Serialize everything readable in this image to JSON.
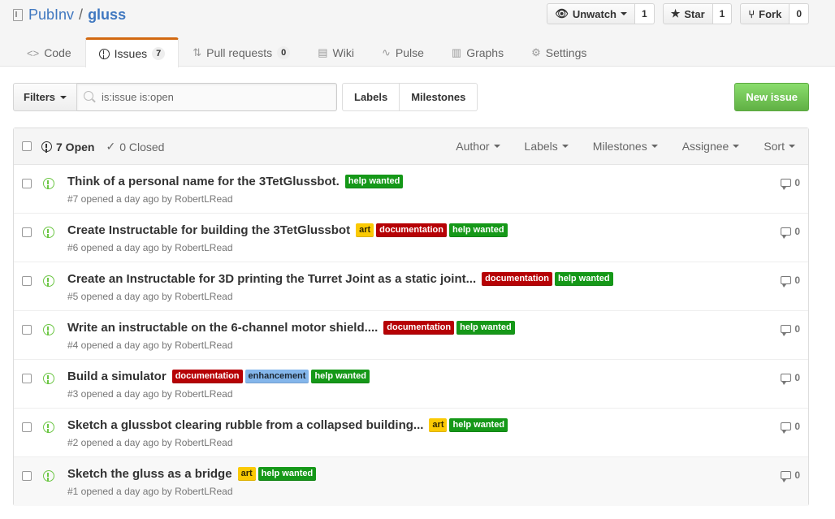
{
  "repo": {
    "owner": "PubInv",
    "separator": "/",
    "name": "gluss"
  },
  "actions": {
    "watch": {
      "label": "Unwatch",
      "count": "1"
    },
    "star": {
      "label": "Star",
      "count": "1"
    },
    "fork": {
      "label": "Fork",
      "count": "0"
    }
  },
  "tabs": [
    {
      "label": "Code",
      "icon": "code-icon"
    },
    {
      "label": "Issues",
      "icon": "issue-opened-icon",
      "count": "7",
      "selected": true
    },
    {
      "label": "Pull requests",
      "icon": "git-pull-request-icon",
      "count": "0"
    },
    {
      "label": "Wiki",
      "icon": "book-icon"
    },
    {
      "label": "Pulse",
      "icon": "pulse-icon"
    },
    {
      "label": "Graphs",
      "icon": "graph-icon"
    },
    {
      "label": "Settings",
      "icon": "gear-icon"
    }
  ],
  "subnav": {
    "filters_label": "Filters",
    "search_value": "is:issue is:open",
    "labels_label": "Labels",
    "milestones_label": "Milestones",
    "new_issue_label": "New issue"
  },
  "table_header": {
    "open_label": "7 Open",
    "closed_label": "0 Closed",
    "filters": [
      "Author",
      "Labels",
      "Milestones",
      "Assignee",
      "Sort"
    ]
  },
  "label_colors": {
    "help wanted": {
      "bg": "#159818",
      "fg": "#ffffff"
    },
    "art": {
      "bg": "#fbca04",
      "fg": "#332900"
    },
    "documentation": {
      "bg": "#b60205",
      "fg": "#ffffff"
    },
    "enhancement": {
      "bg": "#84b6eb",
      "fg": "#1c2733"
    }
  },
  "issues": [
    {
      "title": "Think of a personal name for the 3TetGlussbot.",
      "labels": [
        "help wanted"
      ],
      "meta": "#7 opened a day ago by RobertLRead",
      "comments": "0"
    },
    {
      "title": "Create Instructable for building the 3TetGlussbot",
      "labels": [
        "art",
        "documentation",
        "help wanted"
      ],
      "meta": "#6 opened a day ago by RobertLRead",
      "comments": "0"
    },
    {
      "title": "Create an Instructable for 3D printing the Turret Joint as a static joint...",
      "labels": [
        "documentation",
        "help wanted"
      ],
      "meta": "#5 opened a day ago by RobertLRead",
      "comments": "0"
    },
    {
      "title": "Write an instructable on the 6-channel motor shield....",
      "labels": [
        "documentation",
        "help wanted"
      ],
      "meta": "#4 opened a day ago by RobertLRead",
      "comments": "0"
    },
    {
      "title": "Build a simulator",
      "labels": [
        "documentation",
        "enhancement",
        "help wanted"
      ],
      "meta": "#3 opened a day ago by RobertLRead",
      "comments": "0"
    },
    {
      "title": "Sketch a glussbot clearing rubble from a collapsed building...",
      "labels": [
        "art",
        "help wanted"
      ],
      "meta": "#2 opened a day ago by RobertLRead",
      "comments": "0"
    },
    {
      "title": "Sketch the gluss as a bridge",
      "labels": [
        "art",
        "help wanted"
      ],
      "meta": "#1 opened a day ago by RobertLRead",
      "comments": "0"
    }
  ]
}
